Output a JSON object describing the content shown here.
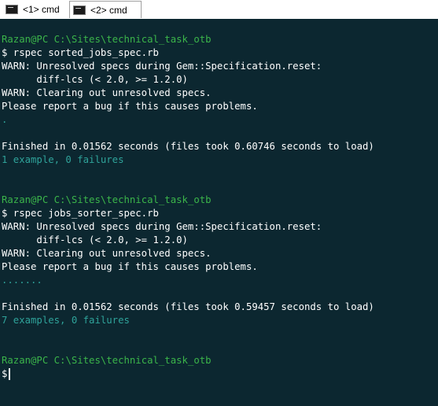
{
  "tabs": [
    {
      "label": "<1> cmd",
      "active": false
    },
    {
      "label": "<2> cmd",
      "active": true
    }
  ],
  "terminal": {
    "blocks": [
      {
        "user": "Razan@PC",
        "path": "C:\\Sites\\technical_task_otb"
      },
      {
        "user": "Razan@PC",
        "path": "C:\\Sites\\technical_task_otb"
      },
      {
        "user": "Razan@PC",
        "path": "C:\\Sites\\technical_task_otb"
      }
    ],
    "lines": [
      "$ rspec sorted_jobs_spec.rb",
      "WARN: Unresolved specs during Gem::Specification.reset:",
      "      diff-lcs (< 2.0, >= 1.2.0)",
      "WARN: Clearing out unresolved specs.",
      "Please report a bug if this causes problems.",
      ".",
      "Finished in 0.01562 seconds (files took 0.60746 seconds to load)",
      "1 example, 0 failures",
      "$ rspec jobs_sorter_spec.rb",
      "WARN: Unresolved specs during Gem::Specification.reset:",
      "      diff-lcs (< 2.0, >= 1.2.0)",
      "WARN: Clearing out unresolved specs.",
      "Please report a bug if this causes problems.",
      ".......",
      "Finished in 0.01562 seconds (files took 0.59457 seconds to load)",
      "7 examples, 0 failures",
      "$"
    ]
  },
  "colors": {
    "background": "#0c2730",
    "prompt_green": "#3bb54a",
    "result_teal": "#2fa39a",
    "text": "#ffffff"
  },
  "icons": {
    "tab_icon": "console-icon"
  }
}
